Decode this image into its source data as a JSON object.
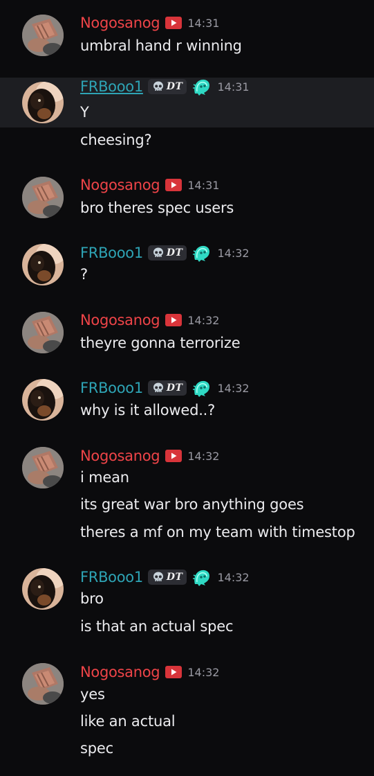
{
  "users": {
    "nog": {
      "name": "Nogosanog",
      "color": "#ee4448"
    },
    "frb": {
      "name": "FRBooo1",
      "color": "#2ea4b5",
      "tag": "DT"
    }
  },
  "messages": [
    {
      "user": "Nogosanog",
      "time": "14:31",
      "lines": [
        "umbral hand r winning"
      ]
    },
    {
      "user": "FRBooo1",
      "tag": "DT",
      "time": "14:31",
      "lines": [
        "Y",
        "cheesing?"
      ]
    },
    {
      "user": "Nogosanog",
      "time": "14:31",
      "lines": [
        "bro theres spec users"
      ]
    },
    {
      "user": "FRBooo1",
      "tag": "DT",
      "time": "14:32",
      "lines": [
        "?"
      ]
    },
    {
      "user": "Nogosanog",
      "time": "14:32",
      "lines": [
        "theyre gonna terrorize"
      ]
    },
    {
      "user": "FRBooo1",
      "tag": "DT",
      "time": "14:32",
      "lines": [
        "why is it allowed..?"
      ]
    },
    {
      "user": "Nogosanog",
      "time": "14:32",
      "lines": [
        "i mean",
        "its great war bro anything goes",
        "theres a mf on my team with timestop"
      ]
    },
    {
      "user": "FRBooo1",
      "tag": "DT",
      "time": "14:32",
      "lines": [
        "bro",
        "is that an actual spec"
      ]
    },
    {
      "user": "Nogosanog",
      "time": "14:32",
      "lines": [
        "yes",
        "like an actual",
        "spec"
      ]
    }
  ],
  "icons": {
    "youtube": "youtube-icon",
    "skull": "skull-icon",
    "ghost": "ghost-icon"
  },
  "colors": {
    "background": "#0b0b0d",
    "highlight": "#1d1e22",
    "timestamp": "#9a9aa3"
  }
}
